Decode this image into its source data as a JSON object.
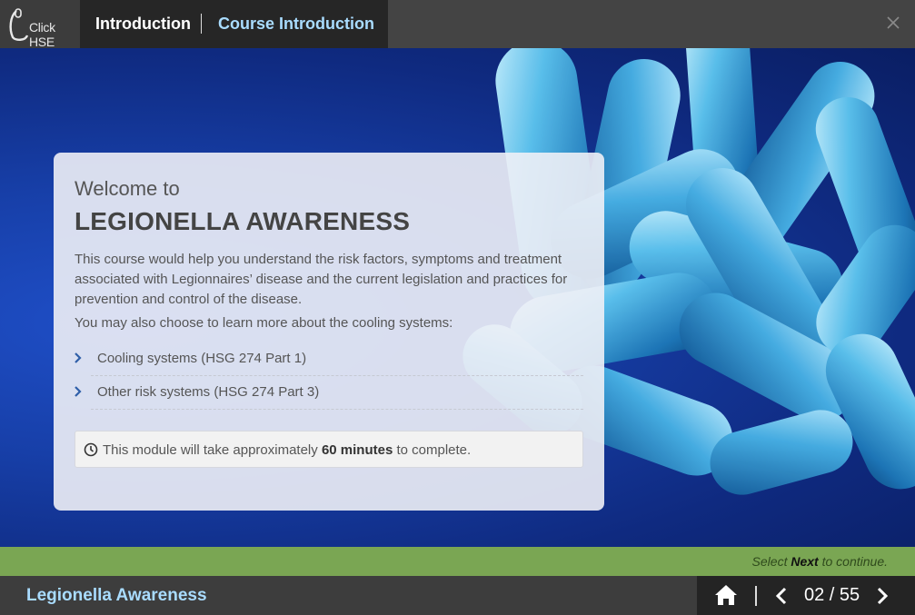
{
  "header": {
    "logo_text": "Click HSE",
    "breadcrumb_section": "Introduction",
    "breadcrumb_page": "Course Introduction",
    "close_icon": "close-icon"
  },
  "card": {
    "welcome": "Welcome to",
    "title": "LEGIONELLA AWARENESS",
    "description": "This course would help you understand the risk factors, symptoms and treatment associated with Legionnaires’ disease and the current legislation and practices for prevention and control of the disease.",
    "choose_text": "You may also choose to learn more about the cooling systems:",
    "links": [
      {
        "label": "Cooling systems (HSG 274 Part 1)"
      },
      {
        "label": "Other risk systems (HSG 274 Part 3)"
      }
    ],
    "note_prefix": "This module will take approximately",
    "note_duration": "60 minutes",
    "note_suffix": "to complete."
  },
  "prompt": {
    "prefix": "Select",
    "keyword": "Next",
    "suffix": "to continue."
  },
  "footer": {
    "course_name": "Legionella Awareness",
    "page_indicator": "02 / 55"
  },
  "colors": {
    "accent_blue": "#a9dcff",
    "progress_green": "#7aa653",
    "background_blue": "#173fa8"
  }
}
